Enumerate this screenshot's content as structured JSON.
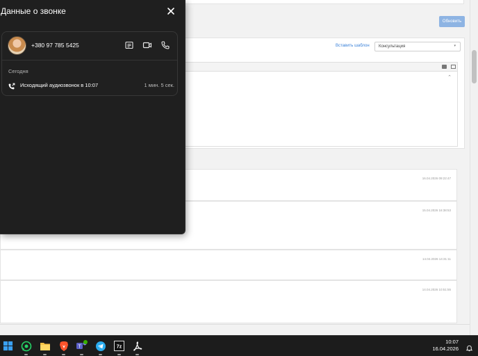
{
  "call_panel": {
    "title": "Данные о звонке",
    "contact": {
      "phone": "+380 97 785 5425"
    },
    "section_label": "Сегодня",
    "call": {
      "description": "Исходящий аудиозвонок в 10:07",
      "duration": "1 мин. 5 сек."
    }
  },
  "background_app": {
    "refresh_button": "Обновить",
    "insert_template_link": "Вставить шаблон",
    "template_select_value": "Консультация",
    "history_timestamps": [
      "16.04.2026 09:22:47",
      "15.04.2026 16:38:53",
      "14.04.2026 14:31:11",
      "14.04.2026 10:51:55"
    ]
  },
  "taskbar": {
    "time": "10:07",
    "date": "16.04.2026",
    "apps": [
      "start-icon",
      "whatsapp-icon",
      "file-explorer-icon",
      "brave-browser-icon",
      "teams-icon",
      "telegram-icon",
      "7zip-icon",
      "acrobat-icon"
    ]
  },
  "colors": {
    "panel_bg": "#1f1f1f",
    "accent_link": "#3b82d9",
    "refresh_button": "#8eb4e3",
    "taskbar_bg": "#1c1c1c"
  }
}
